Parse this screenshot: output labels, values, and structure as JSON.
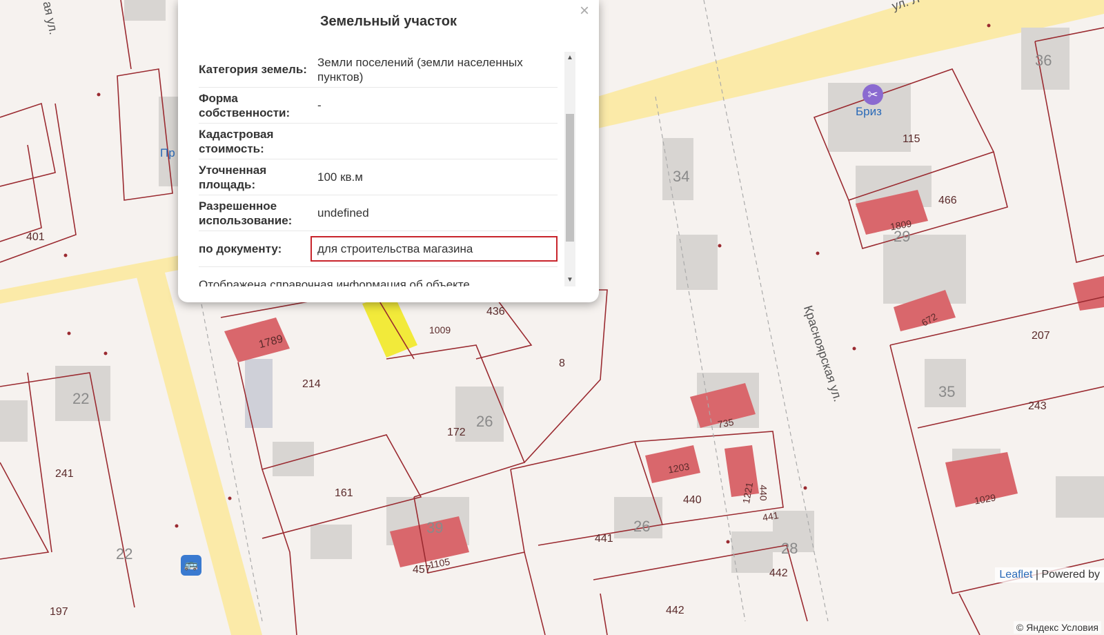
{
  "popup": {
    "title": "Земельный участок",
    "close_glyph": "×",
    "rows": [
      {
        "key": "Категория земель:",
        "value": "Земли поселений (земли населенных пунктов)"
      },
      {
        "key": "Форма собственности:",
        "value": "-"
      },
      {
        "key": "Кадастровая стоимость:",
        "value": ""
      },
      {
        "key": "Уточненная площадь:",
        "value": "100 кв.м"
      },
      {
        "key": "Разрешенное использование:",
        "value": "undefined"
      },
      {
        "key": "по документу:",
        "value": "для строительства магазина"
      }
    ],
    "note": "Отображена справочная информация об объекте."
  },
  "map": {
    "streets": [
      "ул. Л",
      "Красноярская ул.",
      "ая ул."
    ],
    "parcel_labels": [
      "401",
      "1789",
      "214",
      "1009",
      "436",
      "8",
      "172",
      "26",
      "161",
      "22",
      "241",
      "22",
      "197",
      "39",
      "1105",
      "457",
      "34",
      "735",
      "1203",
      "1221",
      "440",
      "440",
      "441",
      "441",
      "26",
      "28",
      "442",
      "442",
      "115",
      "466",
      "1809",
      "29",
      "672",
      "207",
      "35",
      "243",
      "1029",
      "36"
    ],
    "poi": {
      "label": "Бриз",
      "icon": "scissors-icon"
    },
    "poi_partial": "Пр",
    "bus_icon": "bus-stop-icon"
  },
  "attribution": {
    "leaflet": "Leaflet",
    "powered": "| Powered by",
    "yandex": "© Яндекс  Условия"
  },
  "colors": {
    "boundary": "#9a2a30",
    "building_red": "#d9676c",
    "road": "#fbe9a6",
    "highlight": "#c8242b",
    "selected": "#f2ea3a"
  }
}
